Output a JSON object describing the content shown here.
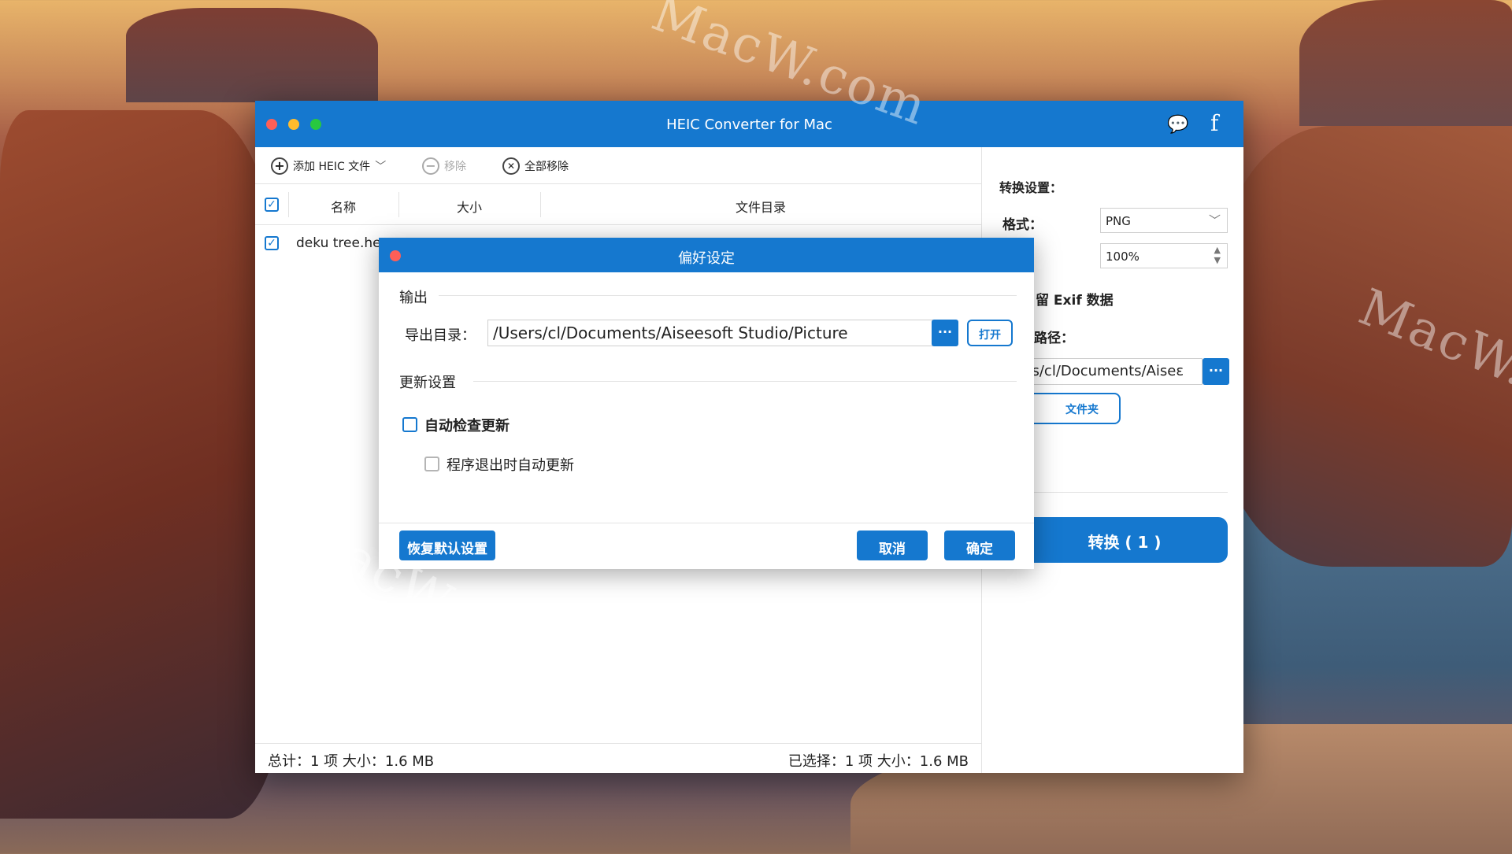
{
  "background": {
    "watermark_top": "MacW.com",
    "watermark_right": "MacW.c",
    "watermark_bottom": "MacW.com"
  },
  "colors": {
    "accent": "#1578cf",
    "close": "#fe5f57",
    "minimize": "#febc2e",
    "zoom": "#28c840"
  },
  "window": {
    "title": "HEIC Converter for Mac",
    "chat_icon": "💬",
    "facebook_icon": "f"
  },
  "toolbar": {
    "add_label": "添加 HEIC 文件",
    "add_icon": "+",
    "remove_label": "移除",
    "remove_icon": "−",
    "remove_all_label": "全部移除",
    "remove_all_icon": "✕",
    "dropdown_icon": "﹀"
  },
  "table": {
    "check_mark": "✓",
    "columns": [
      "名称",
      "大小",
      "文件目录"
    ],
    "rows": [
      {
        "name": "deku tree.he",
        "checked": true
      }
    ]
  },
  "status": {
    "total": "总计：1 项 大小：1.6 MB",
    "selected": "已选择：1 项 大小：1.6 MB"
  },
  "right_panel": {
    "settings_label": "转换设置：",
    "format_label": "格式：",
    "format_value": "PNG",
    "quality_label": "：",
    "quality_value": "100%",
    "exif_label": "留 Exif 数据",
    "path_label": "路径：",
    "path_value": "ers/cl/Documents/Aiseε",
    "more_label": "···",
    "open_folder_label": "文件夹",
    "convert_label": "转换 ( 1 )"
  },
  "dialog": {
    "title": "偏好设定",
    "output_section": "输出",
    "export_dir_label": "导出目录：",
    "export_dir_value": "/Users/cl/Documents/Aiseesoft Studio/Picture",
    "more_label": "···",
    "open_label": "打开",
    "update_section": "更新设置",
    "auto_check_label": "自动检查更新",
    "auto_update_on_exit_label": "程序退出时自动更新",
    "restore_defaults_label": "恢复默认设置",
    "cancel_label": "取消",
    "ok_label": "确定"
  }
}
